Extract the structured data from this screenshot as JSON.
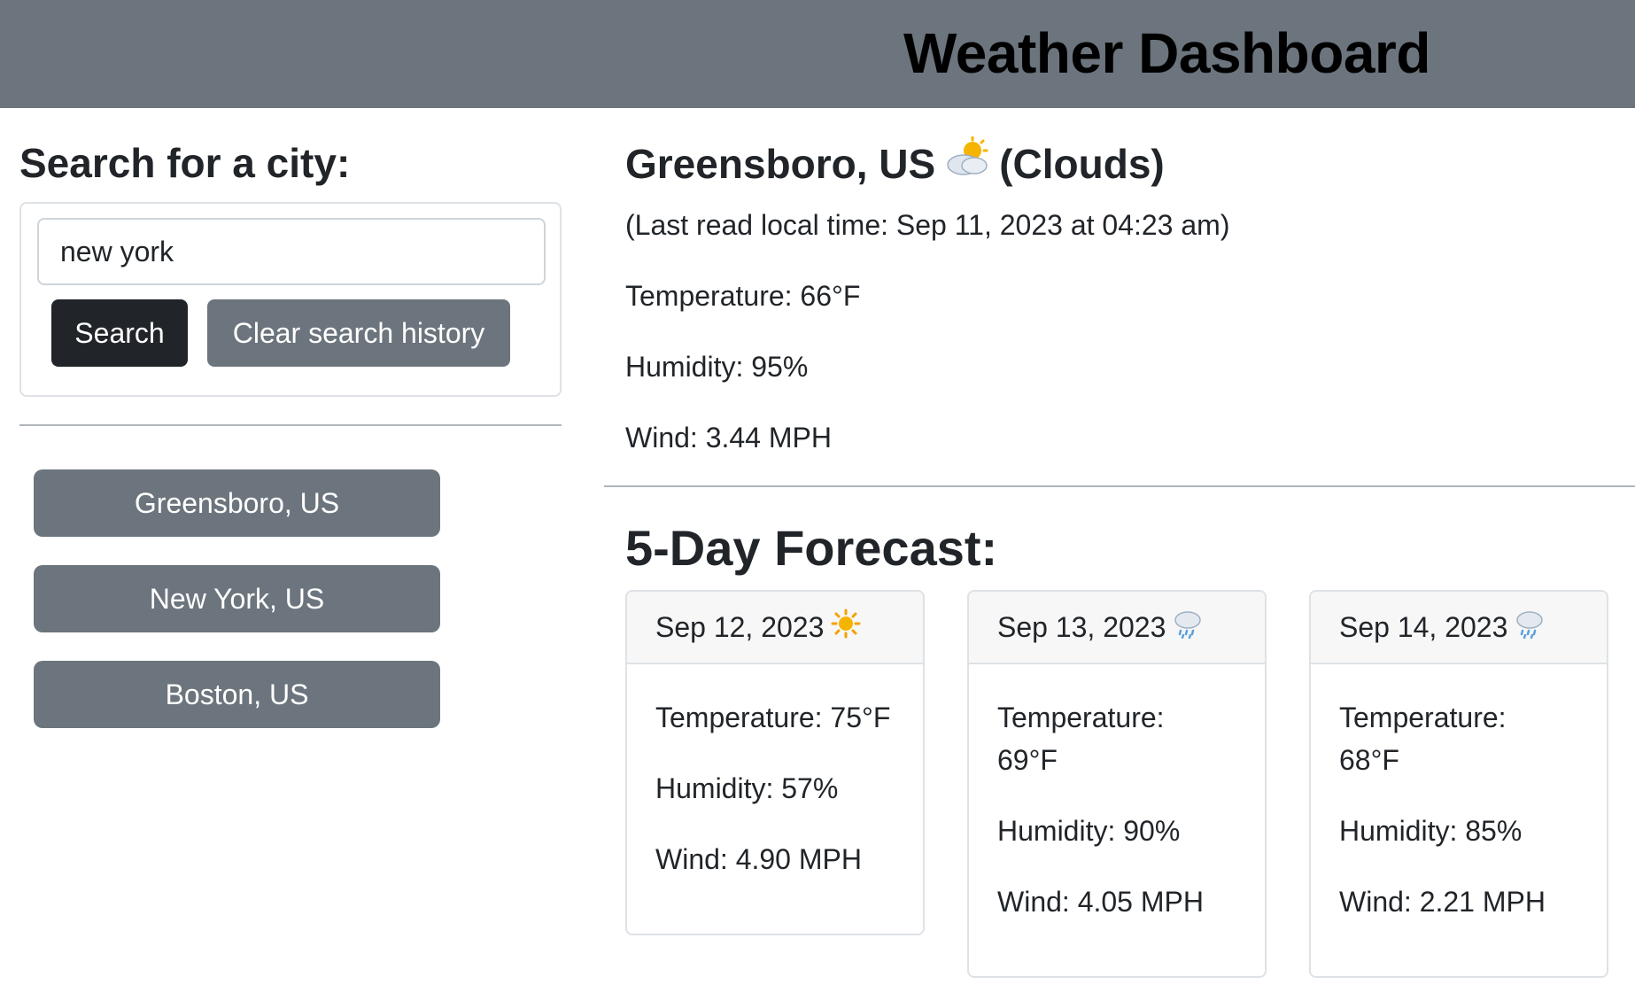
{
  "header": {
    "title": "Weather Dashboard"
  },
  "search": {
    "heading": "Search for a city:",
    "input_value": "new york",
    "search_label": "Search",
    "clear_label": "Clear search history"
  },
  "history": [
    {
      "label": "Greensboro, US"
    },
    {
      "label": "New York, US"
    },
    {
      "label": "Boston, US"
    }
  ],
  "current": {
    "city": "Greensboro, US",
    "icon": "☁",
    "icon_name": "sun-behind-cloud-icon",
    "condition": "(Clouds)",
    "last_read": "(Last read local time: Sep 11, 2023 at 04:23 am)",
    "temperature": "Temperature: 66°F",
    "humidity": "Humidity: 95%",
    "wind": "Wind: 3.44 MPH"
  },
  "forecast": {
    "heading": "5-Day Forecast:",
    "days": [
      {
        "date": "Sep 12, 2023",
        "icon": "☀",
        "icon_name": "sun-icon",
        "temperature": "Temperature: 75°F",
        "humidity": "Humidity: 57%",
        "wind": "Wind: 4.90 MPH"
      },
      {
        "date": "Sep 13, 2023",
        "icon": "☂",
        "icon_name": "rain-cloud-icon",
        "temperature": "Temperature: 69°F",
        "humidity": "Humidity: 90%",
        "wind": "Wind: 4.05 MPH"
      },
      {
        "date": "Sep 14, 2023",
        "icon": "☂",
        "icon_name": "rain-cloud-icon",
        "temperature": "Temperature: 68°F",
        "humidity": "Humidity: 85%",
        "wind": "Wind: 2.21 MPH"
      }
    ]
  }
}
